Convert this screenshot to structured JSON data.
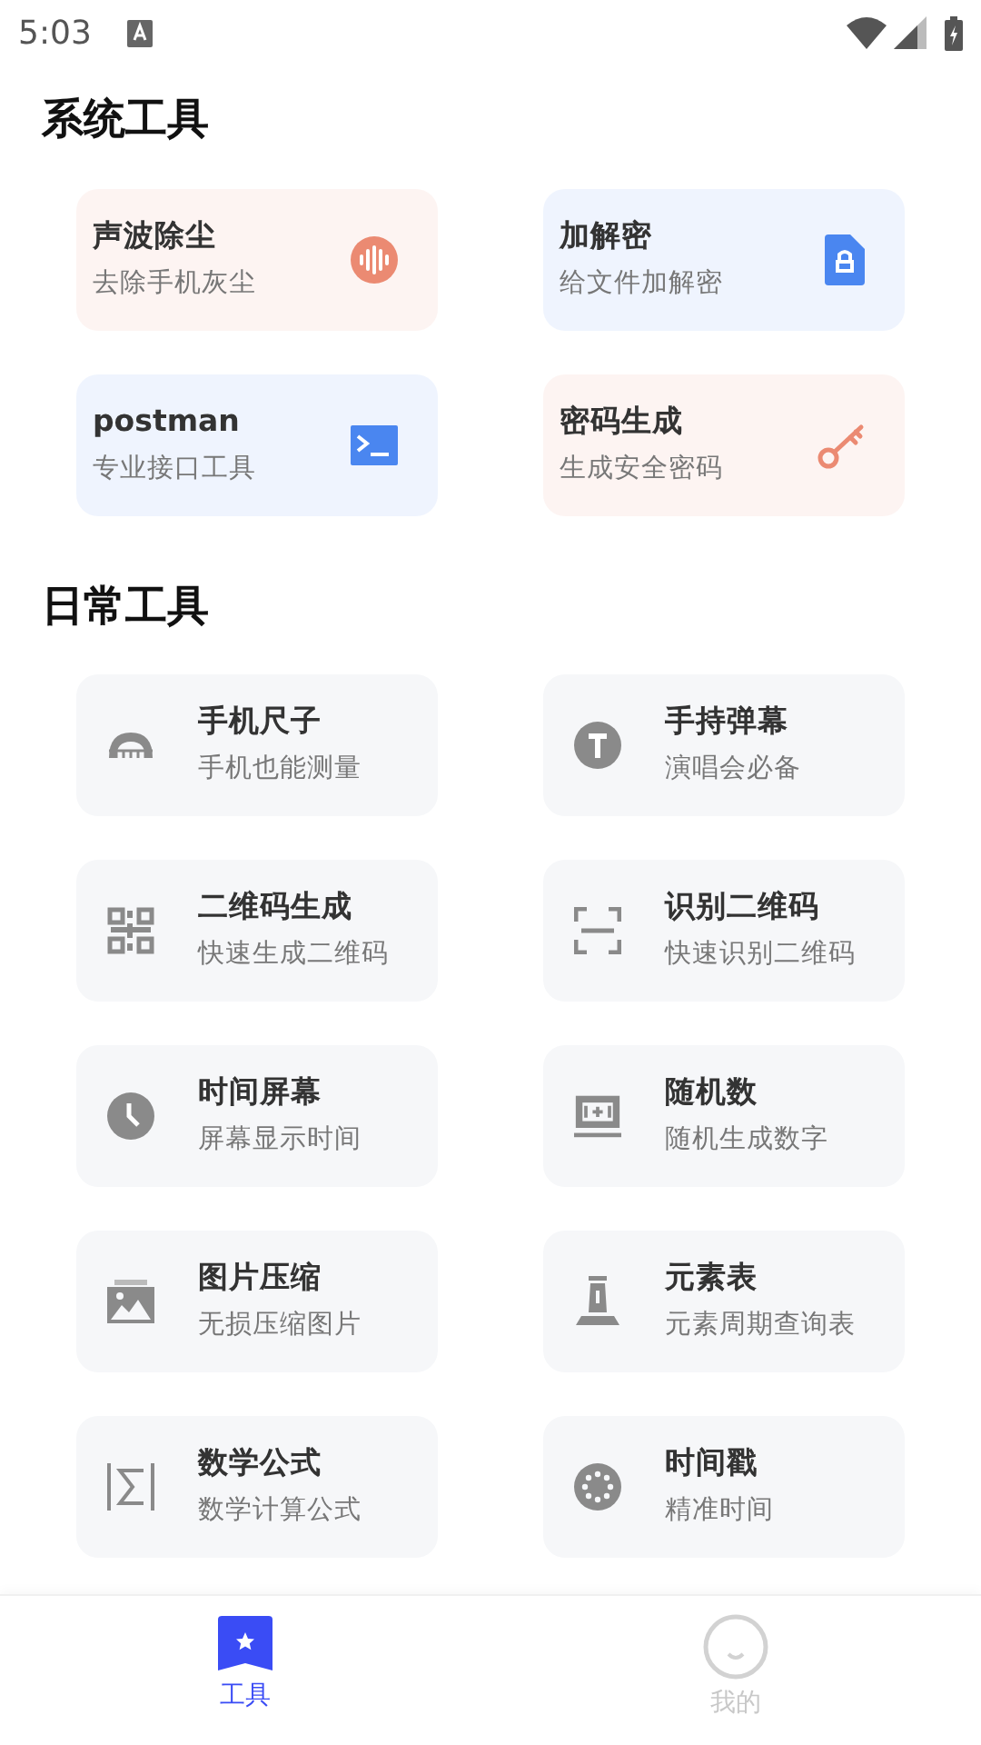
{
  "status_bar": {
    "time": "5:03"
  },
  "sections": [
    {
      "title": "系统工具",
      "kind": "featured",
      "items": [
        {
          "title": "声波除尘",
          "subtitle": "去除手机灰尘",
          "color": "#eb8a72"
        },
        {
          "title": "加解密",
          "subtitle": "给文件加解密",
          "color": "#4a86f0"
        },
        {
          "title": "postman",
          "subtitle": "专业接口工具",
          "color": "#4a86f0"
        },
        {
          "title": "密码生成",
          "subtitle": "生成安全密码",
          "color": "#eb8a72"
        }
      ]
    },
    {
      "title": "日常工具",
      "kind": "plain",
      "items": [
        {
          "title": "手机尺子",
          "subtitle": "手机也能测量"
        },
        {
          "title": "手持弹幕",
          "subtitle": "演唱会必备"
        },
        {
          "title": "二维码生成",
          "subtitle": "快速生成二维码"
        },
        {
          "title": "识别二维码",
          "subtitle": "快速识别二维码"
        },
        {
          "title": "时间屏幕",
          "subtitle": "屏幕显示时间"
        },
        {
          "title": "随机数",
          "subtitle": "随机生成数字"
        },
        {
          "title": "图片压缩",
          "subtitle": "无损压缩图片"
        },
        {
          "title": "元素表",
          "subtitle": "元素周期查询表"
        },
        {
          "title": "数学公式",
          "subtitle": "数学计算公式"
        },
        {
          "title": "时间戳",
          "subtitle": "精准时间"
        }
      ]
    }
  ],
  "bottom_nav": [
    {
      "label": "工具",
      "selected": true
    },
    {
      "label": "我的",
      "selected": false
    }
  ]
}
